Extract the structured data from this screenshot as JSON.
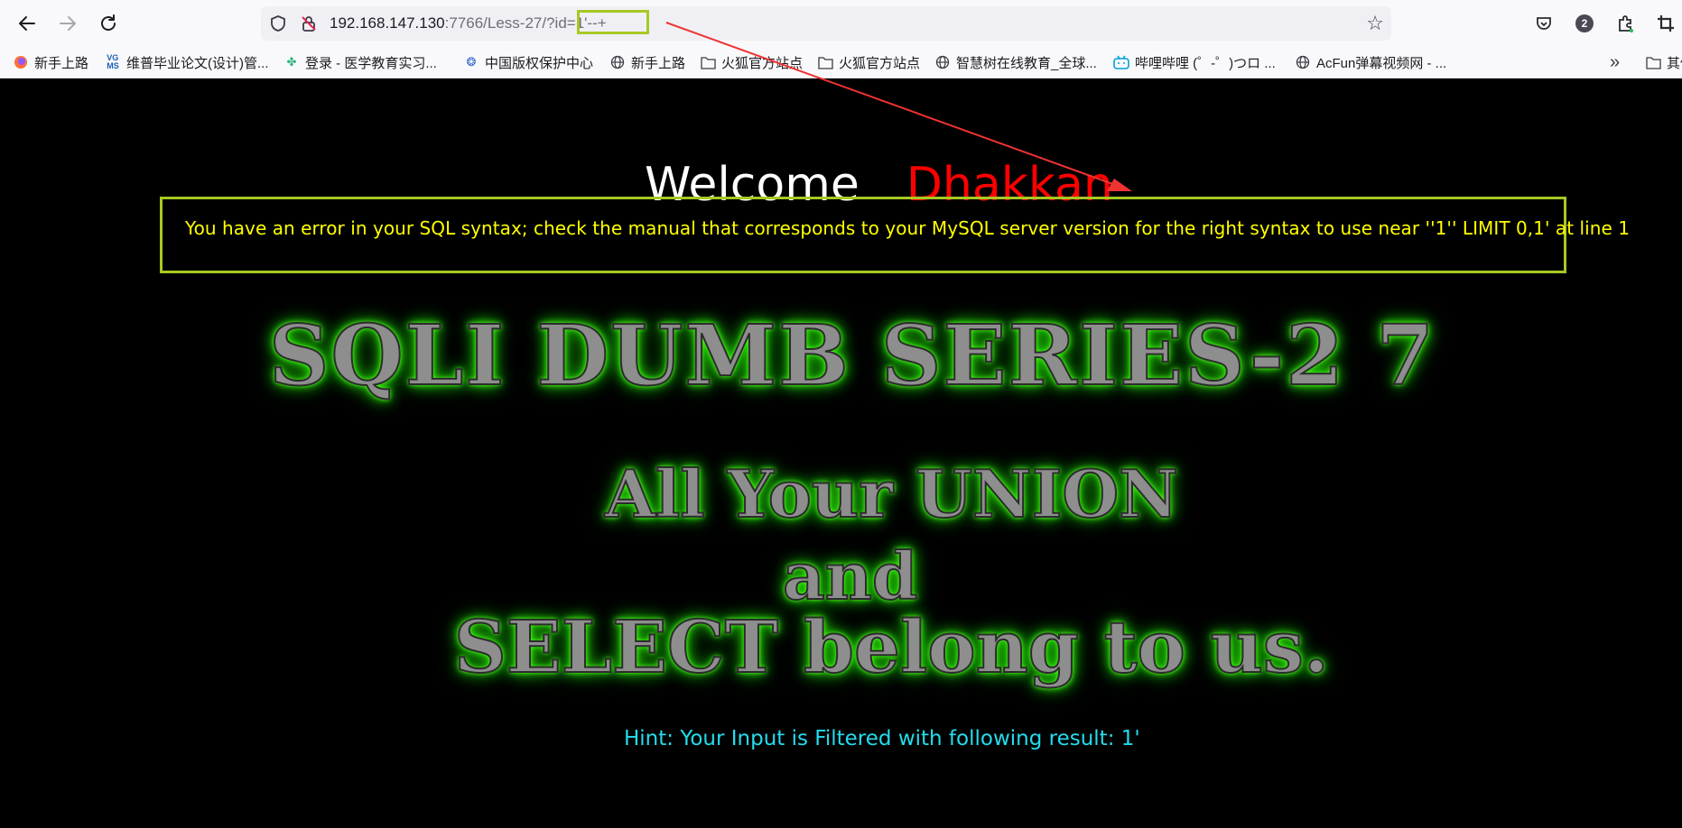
{
  "browser": {
    "url_host": "192.168.147.130",
    "url_rest": ":7766/Less-27/?id=1'--+",
    "extension_badge": "2"
  },
  "bookmarks": [
    {
      "label": "新手上路",
      "icon": "firefox-icon"
    },
    {
      "label": "维普毕业论文(设计)管...",
      "icon": "vgms-icon"
    },
    {
      "label": "登录 - 医学教育实习...",
      "icon": "flower-icon"
    },
    {
      "label": "中国版权保护中心",
      "icon": "brain-icon"
    },
    {
      "label": "新手上路",
      "icon": "globe-icon"
    },
    {
      "label": "火狐官方站点",
      "icon": "folder-icon"
    },
    {
      "label": "火狐官方站点",
      "icon": "folder-icon"
    },
    {
      "label": "智慧树在线教育_全球...",
      "icon": "globe-icon"
    },
    {
      "label": "哔哩哔哩 (゜-゜)つロ ...",
      "icon": "bilibili-icon"
    },
    {
      "label": "AcFun弹幕视频网 - ...",
      "icon": "globe-icon"
    },
    {
      "label": "其他",
      "icon": "folder-icon"
    }
  ],
  "page": {
    "welcome": "Welcome",
    "name": "Dhakkan",
    "error": "You have an error in your SQL syntax; check the manual that corresponds to your MySQL server version for the right syntax to use near ''1'' LIMIT 0,1' at line 1",
    "title_line1": "SQLI DUMB SERIES-2 7",
    "title_line2": "All Your UNION",
    "title_line3": "and",
    "title_line4": "SELECT belong to us.",
    "hint": "Hint: Your Input is Filtered with following result: 1'"
  },
  "colors": {
    "error_text": "#ffff00",
    "name": "#ff0000",
    "hint": "#22ddee",
    "highlight_box": "#a7c921",
    "annotation_arrow": "#ee3333",
    "title_glow": "#33ff00"
  }
}
